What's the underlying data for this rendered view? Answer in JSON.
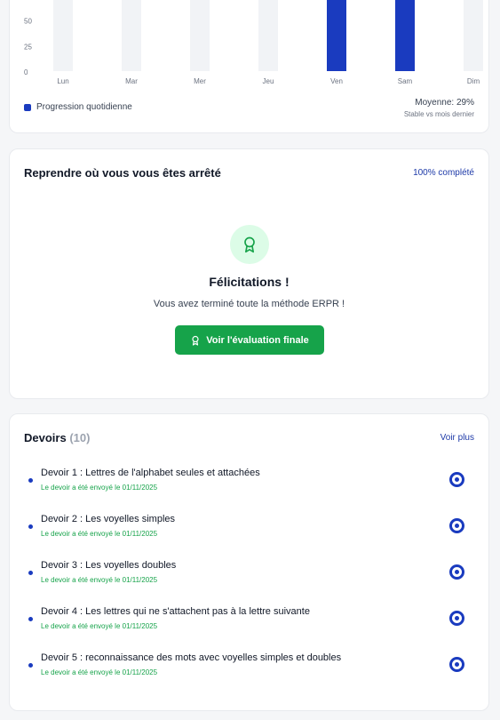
{
  "chart_data": {
    "type": "bar",
    "categories": [
      "Lun",
      "Mar",
      "Mer",
      "Jeu",
      "Ven",
      "Sam",
      "Dim"
    ],
    "values": [
      0,
      0,
      0,
      0,
      100,
      100,
      0
    ],
    "yticks": [
      "0",
      "25",
      "50"
    ],
    "ylim": [
      0,
      100
    ],
    "colors": {
      "active": "#1a3bbf",
      "empty": "#f1f3f6"
    },
    "legend": "Progression quotidienne",
    "grid": false
  },
  "stats": {
    "average": "Moyenne: 29%",
    "comparison": "Stable vs mois dernier"
  },
  "resume": {
    "title": "Reprendre où vous vous êtes arrêté",
    "progress": "100% complété",
    "congrats_title": "Félicitations !",
    "congrats_text": "Vous avez terminé toute la méthode ERPR !",
    "button_label": "Voir l'évaluation finale",
    "icon": "award-icon"
  },
  "homework": {
    "title": "Devoirs",
    "count": "(10)",
    "see_more": "Voir plus",
    "items": [
      {
        "title": "Devoir 1 : Lettres de l'alphabet seules et attachées",
        "status": "Le devoir a été envoyé le 01/11/2025"
      },
      {
        "title": "Devoir 2 : Les voyelles simples",
        "status": "Le devoir a été envoyé le 01/11/2025"
      },
      {
        "title": "Devoir 3 : Les voyelles doubles",
        "status": "Le devoir a été envoyé le 01/11/2025"
      },
      {
        "title": "Devoir 4 : Les lettres qui ne s'attachent pas à la lettre suivante",
        "status": "Le devoir a été envoyé le 01/11/2025"
      },
      {
        "title": "Devoir 5 : reconnaissance des mots avec voyelles simples et doubles",
        "status": "Le devoir a été envoyé le 01/11/2025"
      }
    ]
  }
}
